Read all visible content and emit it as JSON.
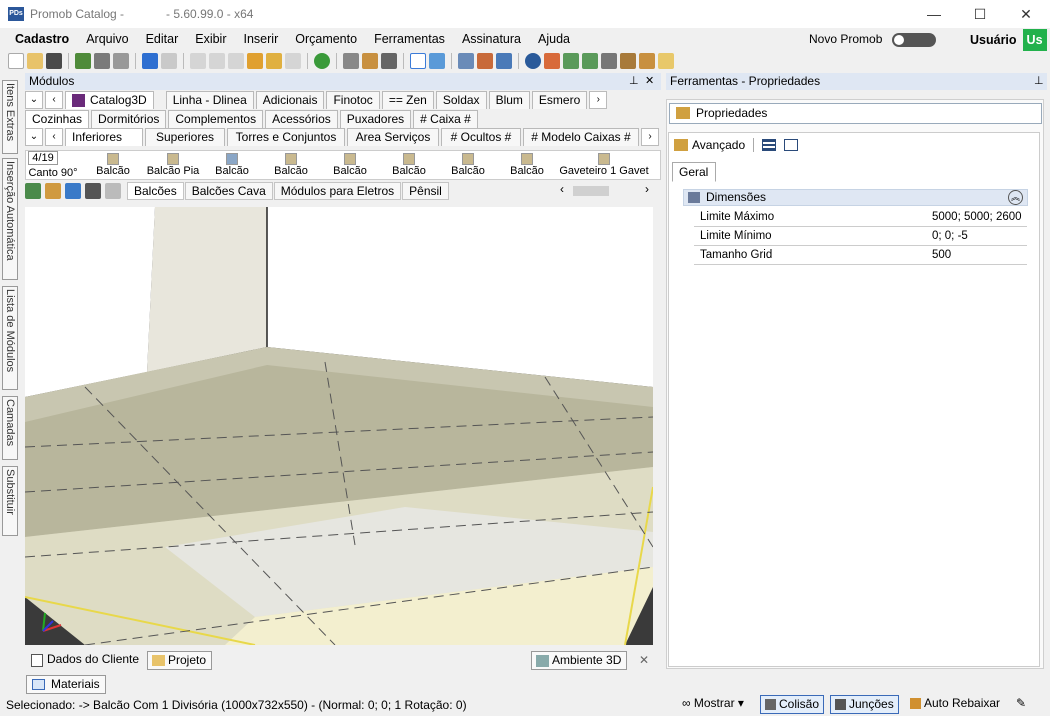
{
  "window": {
    "title": "Promob Catalog -",
    "version": "- 5.60.99.0 - x64",
    "logo_text": "PDs",
    "minimize": "—",
    "maximize": "☐",
    "close": "✕"
  },
  "menu": {
    "items": [
      "Cadastro",
      "Arquivo",
      "Editar",
      "Exibir",
      "Inserir",
      "Orçamento",
      "Ferramentas",
      "Assinatura",
      "Ajuda"
    ],
    "novo_promob": "Novo Promob",
    "usuario": "Usuário",
    "user_badge": "Us"
  },
  "left_tabs": [
    "Itens Extras",
    "Inserção Automática",
    "Lista de Módulos",
    "Camadas",
    "Substituir"
  ],
  "modules": {
    "header": "Módulos",
    "row1": [
      "Catalog3D",
      "Linha - Dlinea",
      "Adicionais",
      "Finotoc",
      "Zen",
      "Soldax",
      "Blum",
      "Esmero"
    ],
    "row2": [
      "Cozinhas",
      "Dormitórios",
      "Complementos",
      "Acessórios",
      "Puxadores",
      "# Caixa #"
    ],
    "row3": [
      "Inferiores",
      "Superiores",
      "Torres e Conjuntos",
      "Area Serviços",
      "# Ocultos #",
      "# Modelo Caixas #"
    ],
    "counter": "4/19",
    "thumbs": [
      "Canto 90°",
      "Balcão",
      "Balcão Pia",
      "Balcão",
      "Balcão",
      "Balcão",
      "Balcão",
      "Balcão",
      "Balcão",
      "Gaveteiro 1 Gavet"
    ],
    "subtabs": [
      "Balcões",
      "Balcões Cava",
      "Módulos para Eletros",
      "Pênsil"
    ]
  },
  "doc_tabs": {
    "dados": "Dados do Cliente",
    "projeto": "Projeto",
    "ambiente": "Ambiente 3D",
    "close": "✕"
  },
  "properties": {
    "header": "Ferramentas - Propriedades",
    "title": "Propriedades",
    "avancado": "Avançado",
    "tab": "Geral",
    "group": "Dimensões",
    "rows": [
      {
        "key": "Limite Máximo",
        "value": "5000; 5000; 2600"
      },
      {
        "key": "Limite Mínimo",
        "value": "0; 0; -5"
      },
      {
        "key": "Tamanho Grid",
        "value": "500"
      }
    ]
  },
  "materiais": "Materiais",
  "status": {
    "text": "Selecionado:  -> Balcão Com 1 Divisória (1000x732x550) - (Normal: 0; 0; 1 Rotação: 0)",
    "mostrar": "Mostrar",
    "colisao": "Colisão",
    "juncoes": "Junções",
    "auto_rebaixar": "Auto Rebaixar"
  }
}
